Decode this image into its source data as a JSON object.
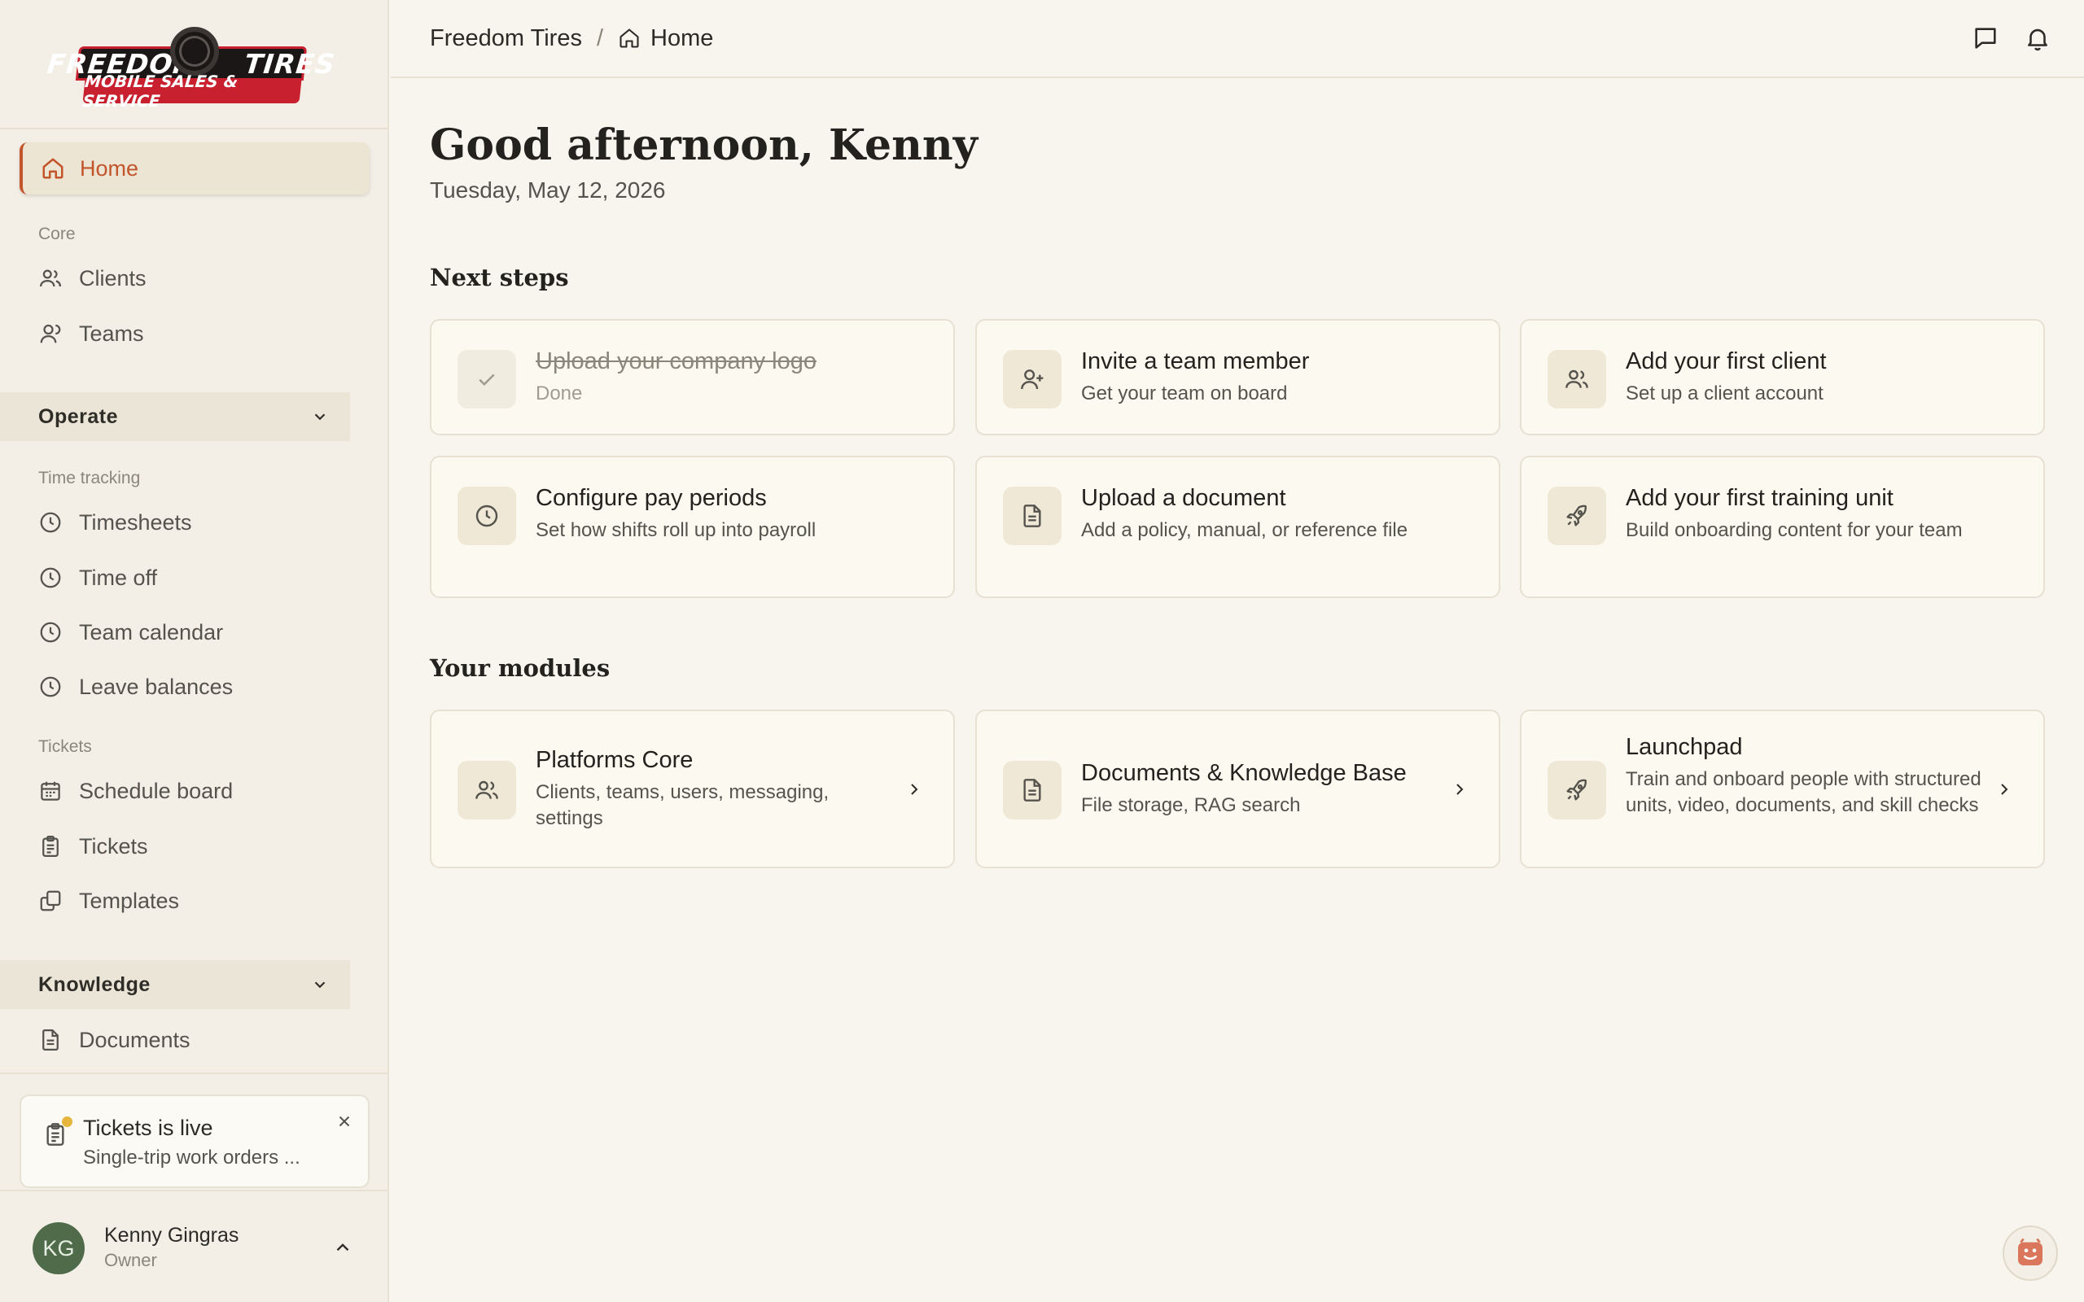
{
  "logo": {
    "line1_left": "FREEDOM",
    "line1_right": "TIRES",
    "line2": "MOBILE SALES & SERVICE"
  },
  "sidebar": {
    "home_label": "Home",
    "core_label": "Core",
    "core_items": [
      {
        "label": "Clients",
        "icon": "users-icon"
      },
      {
        "label": "Teams",
        "icon": "user-icon"
      }
    ],
    "operate_label": "Operate",
    "time_tracking_label": "Time tracking",
    "time_items": [
      {
        "label": "Timesheets",
        "icon": "clock-icon"
      },
      {
        "label": "Time off",
        "icon": "clock-icon"
      },
      {
        "label": "Team calendar",
        "icon": "clock-icon"
      },
      {
        "label": "Leave balances",
        "icon": "clock-icon"
      }
    ],
    "tickets_label": "Tickets",
    "ticket_items": [
      {
        "label": "Schedule board",
        "icon": "calendar-icon"
      },
      {
        "label": "Tickets",
        "icon": "clipboard-icon"
      },
      {
        "label": "Templates",
        "icon": "copy-icon"
      }
    ],
    "knowledge_label": "Knowledge",
    "knowledge_items": [
      {
        "label": "Documents",
        "icon": "document-icon"
      }
    ]
  },
  "toast": {
    "title": "Tickets is live",
    "subtitle": "Single-trip work orders ..."
  },
  "user": {
    "initials": "KG",
    "name": "Kenny Gingras",
    "role": "Owner",
    "avatar_color": "#4f6b4a"
  },
  "header": {
    "org": "Freedom Tires",
    "separator": "/",
    "page": "Home"
  },
  "main": {
    "greeting": "Good afternoon, Kenny",
    "date": "Tuesday, May 12, 2026",
    "next_steps_title": "Next steps",
    "next_steps": [
      {
        "title": "Upload your company logo",
        "subtitle": "Done",
        "icon": "check-icon",
        "done": true
      },
      {
        "title": "Invite a team member",
        "subtitle": "Get your team on board",
        "icon": "user-plus-icon"
      },
      {
        "title": "Add your first client",
        "subtitle": "Set up a client account",
        "icon": "users-icon"
      },
      {
        "title": "Configure pay periods",
        "subtitle": "Set how shifts roll up into payroll",
        "icon": "clock-icon"
      },
      {
        "title": "Upload a document",
        "subtitle": "Add a policy, manual, or reference file",
        "icon": "document-icon"
      },
      {
        "title": "Add your first training unit",
        "subtitle": "Build onboarding content for your team",
        "icon": "rocket-icon"
      }
    ],
    "modules_title": "Your modules",
    "modules": [
      {
        "title": "Platforms Core",
        "subtitle": "Clients, teams, users, messaging, settings",
        "icon": "users-icon"
      },
      {
        "title": "Documents & Knowledge Base",
        "subtitle": "File storage, RAG search",
        "icon": "document-icon"
      },
      {
        "title": "Launchpad",
        "subtitle": "Train and onboard people with structured units, video, documents, and skill checks",
        "icon": "rocket-icon"
      }
    ]
  },
  "colors": {
    "accent": "#c2552c",
    "background": "#f8f5ee",
    "sidebar": "#f3efe6",
    "card": "#fcf9f0",
    "notice_dot": "#e6b53c"
  }
}
